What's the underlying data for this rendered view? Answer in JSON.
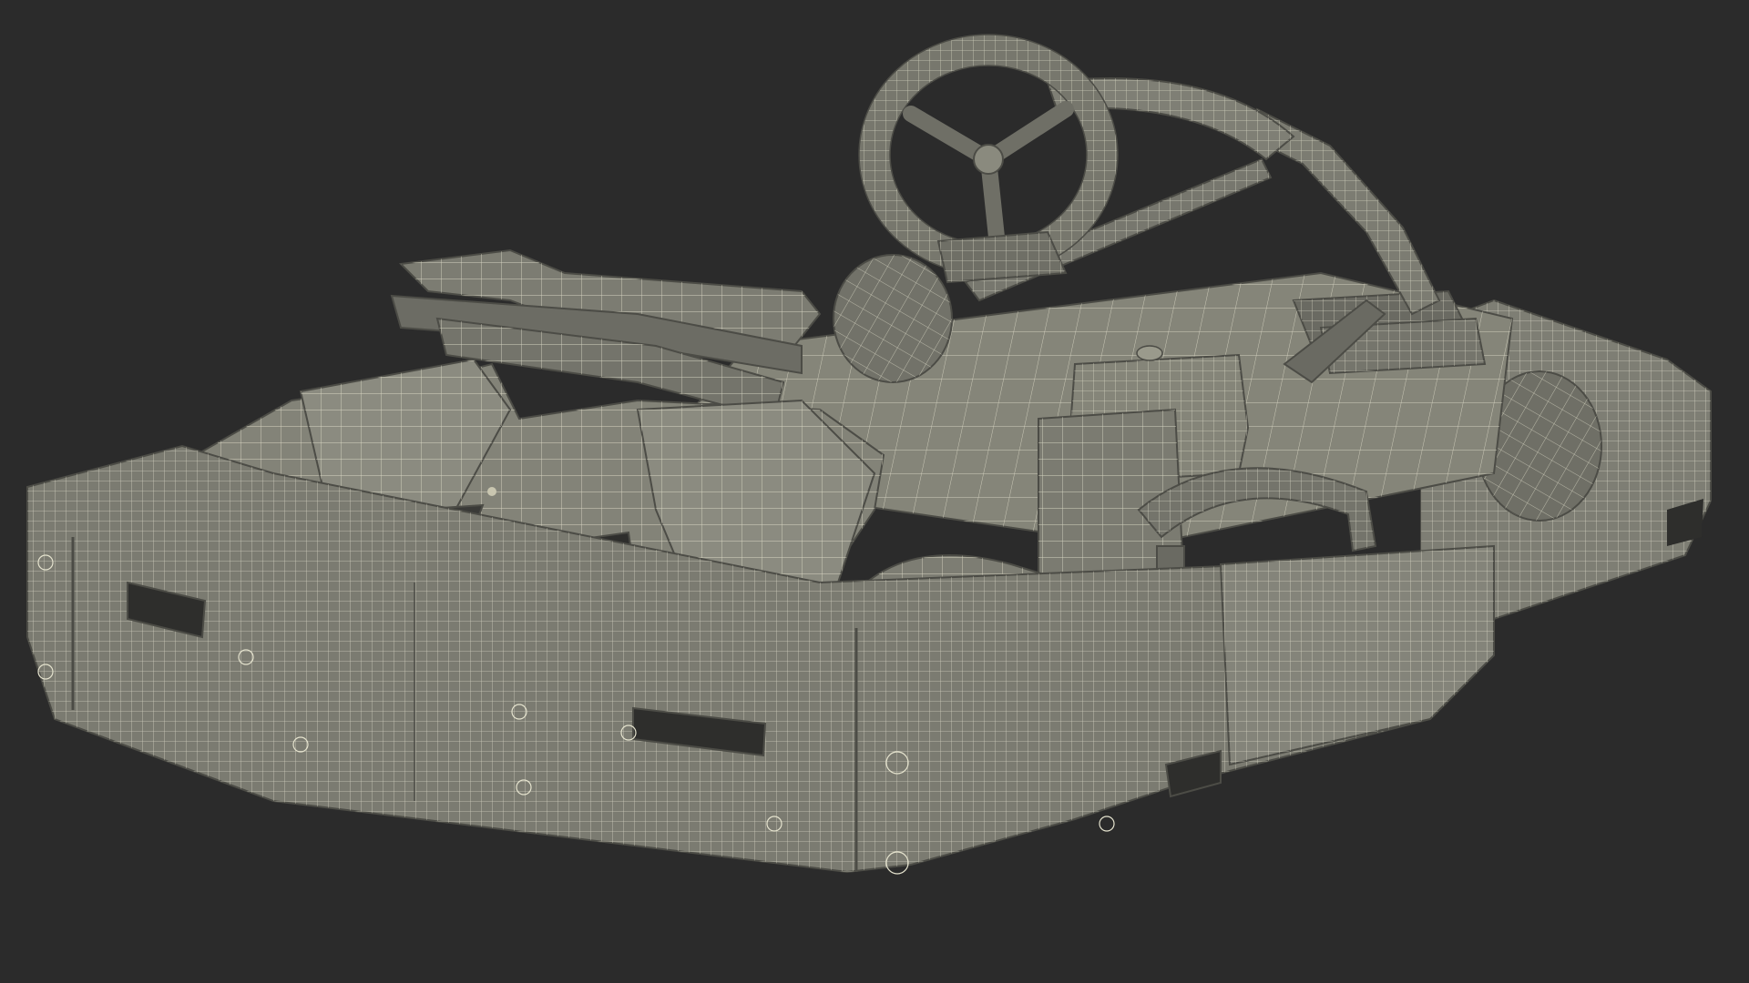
{
  "scene": {
    "subject": "go-kart-wireframe-render",
    "colors": {
      "background": "#2b2b2b",
      "surface": "#7e7e74",
      "surface_light": "#979789",
      "surface_dark": "#5f5f57",
      "wire": "#e6e4cf",
      "shadow": "#4c4c46",
      "hole": "#2e2e2c"
    }
  }
}
